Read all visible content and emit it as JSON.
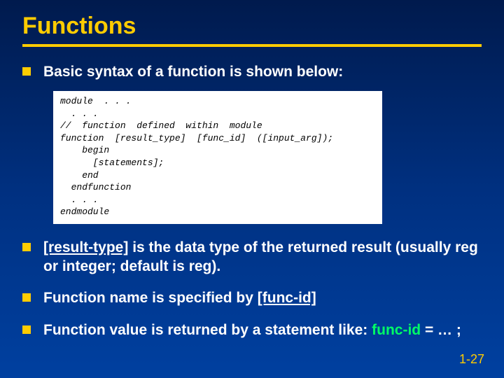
{
  "title": "Functions",
  "bullets": {
    "b1": "Basic syntax of a function is shown below:",
    "b2_part1": "[result-type]",
    "b2_part2": " is the data type of the returned result (usually reg or integer; default is reg).",
    "b3_part1": "Function name",
    "b3_part2": " is specified by ",
    "b3_part3": "[func-id]",
    "b4_part1": "Function value is returned by a statement like: ",
    "b4_part2": "func-id",
    "b4_part3": " = … ;"
  },
  "code": {
    "l1": "module  . . .",
    "l2": "  . . .",
    "l3": "//  function  defined  within  module",
    "l4": "function  [result_type]  [func_id]  ([input_arg]);",
    "l5": "    begin",
    "l6": "      [statements];",
    "l7": "    end",
    "l8": "  endfunction",
    "l9": "  . . .",
    "l10": "endmodule"
  },
  "slide_number": "1-27"
}
